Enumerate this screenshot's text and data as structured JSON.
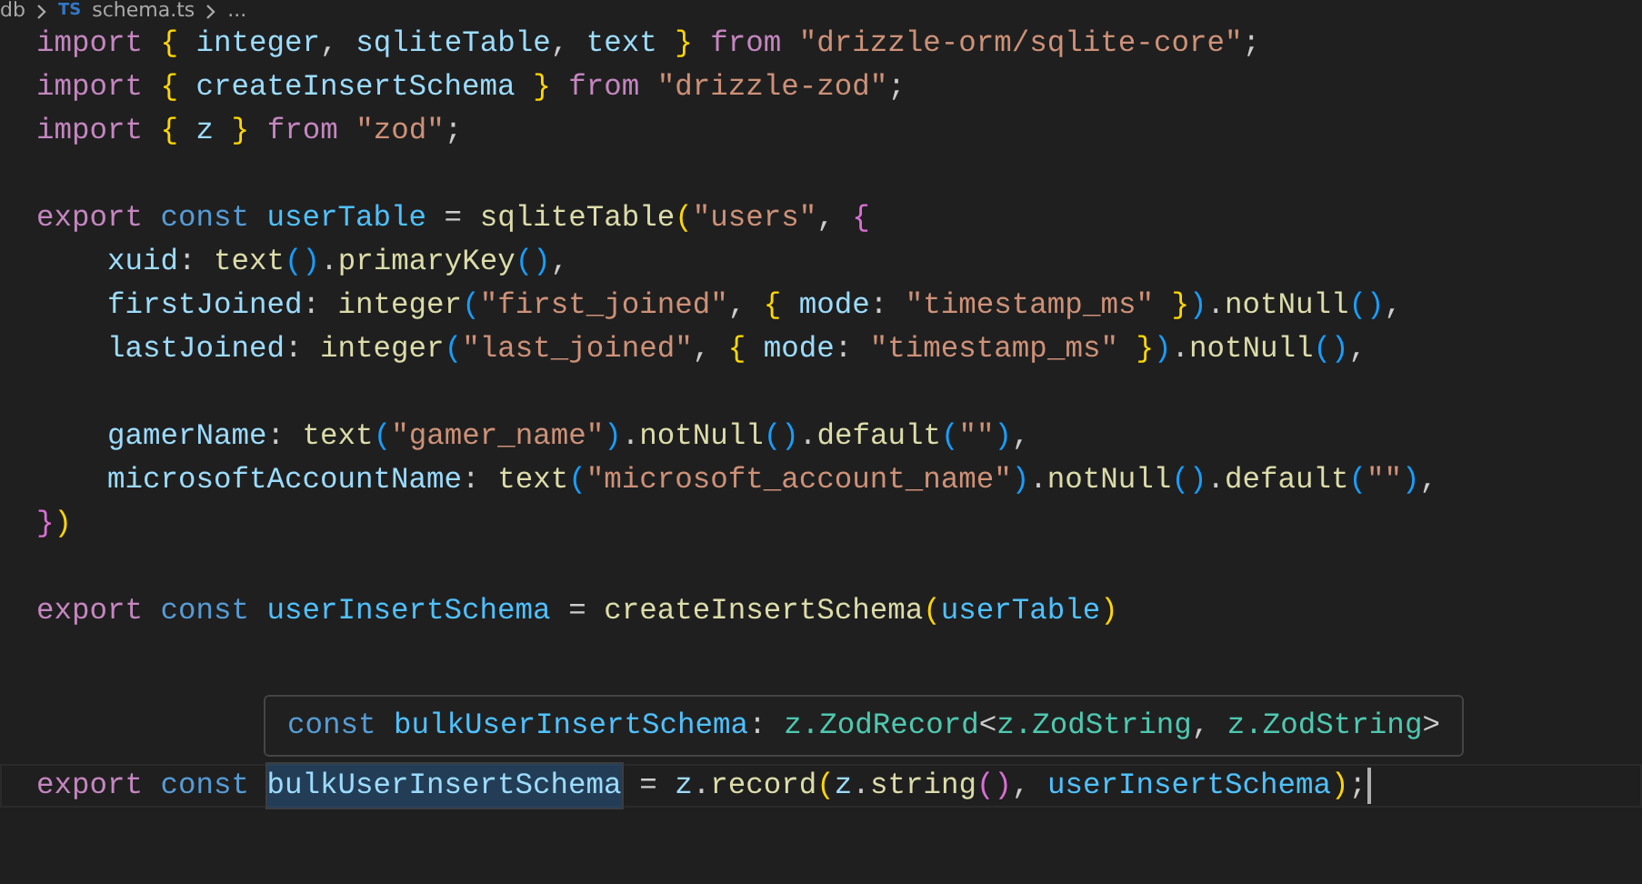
{
  "breadcrumb": {
    "folder": "db",
    "file_icon": "TS",
    "file": "schema.ts",
    "more": "..."
  },
  "code_lines": [
    {
      "tokens": [
        {
          "kind": "kw",
          "text": "import"
        },
        {
          "kind": "b1",
          "text": " {"
        },
        {
          "kind": "var",
          "text": " integer"
        },
        {
          "kind": "plain",
          "text": ", "
        },
        {
          "kind": "var",
          "text": "sqliteTable"
        },
        {
          "kind": "plain",
          "text": ", "
        },
        {
          "kind": "var",
          "text": "text "
        },
        {
          "kind": "b1",
          "text": "}"
        },
        {
          "kind": "kw",
          "text": " from "
        },
        {
          "kind": "str",
          "text": "\"drizzle-orm/sqlite-core\""
        },
        {
          "kind": "plain",
          "text": ";"
        }
      ]
    },
    {
      "tokens": [
        {
          "kind": "kw",
          "text": "import"
        },
        {
          "kind": "b1",
          "text": " {"
        },
        {
          "kind": "var",
          "text": " createInsertSchema "
        },
        {
          "kind": "b1",
          "text": "}"
        },
        {
          "kind": "kw",
          "text": " from "
        },
        {
          "kind": "str",
          "text": "\"drizzle-zod\""
        },
        {
          "kind": "plain",
          "text": ";"
        }
      ]
    },
    {
      "tokens": [
        {
          "kind": "kw",
          "text": "import"
        },
        {
          "kind": "b1",
          "text": " {"
        },
        {
          "kind": "var",
          "text": " z "
        },
        {
          "kind": "b1",
          "text": "}"
        },
        {
          "kind": "kw",
          "text": " from "
        },
        {
          "kind": "str",
          "text": "\"zod\""
        },
        {
          "kind": "plain",
          "text": ";"
        }
      ]
    },
    {
      "blank_line_before": true,
      "tokens": [
        {
          "kind": "kw",
          "text": "export"
        },
        {
          "kind": "storage",
          "text": " const "
        },
        {
          "kind": "const",
          "text": "userTable"
        },
        {
          "kind": "plain",
          "text": " = "
        },
        {
          "kind": "fn",
          "text": "sqliteTable"
        },
        {
          "kind": "b1",
          "text": "("
        },
        {
          "kind": "str",
          "text": "\"users\""
        },
        {
          "kind": "plain",
          "text": ", "
        },
        {
          "kind": "b2",
          "text": "{"
        }
      ]
    },
    {
      "tokens": [
        {
          "kind": "var",
          "text": "    xuid"
        },
        {
          "kind": "plain",
          "text": ": "
        },
        {
          "kind": "fn",
          "text": "text"
        },
        {
          "kind": "b3",
          "text": "()"
        },
        {
          "kind": "plain",
          "text": "."
        },
        {
          "kind": "fn",
          "text": "primaryKey"
        },
        {
          "kind": "b3",
          "text": "()"
        },
        {
          "kind": "plain",
          "text": ","
        }
      ]
    },
    {
      "tokens": [
        {
          "kind": "var",
          "text": "    firstJoined"
        },
        {
          "kind": "plain",
          "text": ": "
        },
        {
          "kind": "fn",
          "text": "integer"
        },
        {
          "kind": "b3",
          "text": "("
        },
        {
          "kind": "str",
          "text": "\"first_joined\""
        },
        {
          "kind": "plain",
          "text": ", "
        },
        {
          "kind": "b1",
          "text": "{"
        },
        {
          "kind": "var",
          "text": " mode"
        },
        {
          "kind": "plain",
          "text": ": "
        },
        {
          "kind": "str",
          "text": "\"timestamp_ms\""
        },
        {
          "kind": "b1",
          "text": " }"
        },
        {
          "kind": "b3",
          "text": ")"
        },
        {
          "kind": "plain",
          "text": "."
        },
        {
          "kind": "fn",
          "text": "notNull"
        },
        {
          "kind": "b3",
          "text": "()"
        },
        {
          "kind": "plain",
          "text": ","
        }
      ]
    },
    {
      "tokens": [
        {
          "kind": "var",
          "text": "    lastJoined"
        },
        {
          "kind": "plain",
          "text": ": "
        },
        {
          "kind": "fn",
          "text": "integer"
        },
        {
          "kind": "b3",
          "text": "("
        },
        {
          "kind": "str",
          "text": "\"last_joined\""
        },
        {
          "kind": "plain",
          "text": ", "
        },
        {
          "kind": "b1",
          "text": "{"
        },
        {
          "kind": "var",
          "text": " mode"
        },
        {
          "kind": "plain",
          "text": ": "
        },
        {
          "kind": "str",
          "text": "\"timestamp_ms\""
        },
        {
          "kind": "b1",
          "text": " }"
        },
        {
          "kind": "b3",
          "text": ")"
        },
        {
          "kind": "plain",
          "text": "."
        },
        {
          "kind": "fn",
          "text": "notNull"
        },
        {
          "kind": "b3",
          "text": "()"
        },
        {
          "kind": "plain",
          "text": ","
        }
      ]
    },
    {
      "blank_line_before": true,
      "tokens": [
        {
          "kind": "var",
          "text": "    gamerName"
        },
        {
          "kind": "plain",
          "text": ": "
        },
        {
          "kind": "fn",
          "text": "text"
        },
        {
          "kind": "b3",
          "text": "("
        },
        {
          "kind": "str",
          "text": "\"gamer_name\""
        },
        {
          "kind": "b3",
          "text": ")"
        },
        {
          "kind": "plain",
          "text": "."
        },
        {
          "kind": "fn",
          "text": "notNull"
        },
        {
          "kind": "b3",
          "text": "()"
        },
        {
          "kind": "plain",
          "text": "."
        },
        {
          "kind": "fn",
          "text": "default"
        },
        {
          "kind": "b3",
          "text": "("
        },
        {
          "kind": "str",
          "text": "\"\""
        },
        {
          "kind": "b3",
          "text": ")"
        },
        {
          "kind": "plain",
          "text": ","
        }
      ]
    },
    {
      "tokens": [
        {
          "kind": "var",
          "text": "    microsoftAccountName"
        },
        {
          "kind": "plain",
          "text": ": "
        },
        {
          "kind": "fn",
          "text": "text"
        },
        {
          "kind": "b3",
          "text": "("
        },
        {
          "kind": "str",
          "text": "\"microsoft_account_name\""
        },
        {
          "kind": "b3",
          "text": ")"
        },
        {
          "kind": "plain",
          "text": "."
        },
        {
          "kind": "fn",
          "text": "notNull"
        },
        {
          "kind": "b3",
          "text": "()"
        },
        {
          "kind": "plain",
          "text": "."
        },
        {
          "kind": "fn",
          "text": "default"
        },
        {
          "kind": "b3",
          "text": "("
        },
        {
          "kind": "str",
          "text": "\"\""
        },
        {
          "kind": "b3",
          "text": ")"
        },
        {
          "kind": "plain",
          "text": ","
        }
      ]
    },
    {
      "tokens": [
        {
          "kind": "b2",
          "text": "}"
        },
        {
          "kind": "b1",
          "text": ")"
        }
      ]
    },
    {
      "blank_line_before": true,
      "tokens": [
        {
          "kind": "kw",
          "text": "export"
        },
        {
          "kind": "storage",
          "text": " const "
        },
        {
          "kind": "const",
          "text": "userInsertSchema"
        },
        {
          "kind": "plain",
          "text": " = "
        },
        {
          "kind": "fn",
          "text": "createInsertSchema"
        },
        {
          "kind": "b1",
          "text": "("
        },
        {
          "kind": "const",
          "text": "userTable"
        },
        {
          "kind": "b1",
          "text": ")"
        }
      ]
    },
    {
      "three_blank_lines_before": true,
      "cursor": true,
      "tokens": [
        {
          "kind": "kw",
          "text": "export"
        },
        {
          "kind": "storage",
          "text": " const "
        },
        {
          "kind": "match",
          "text": "bulkUserInsertSchema"
        },
        {
          "kind": "plain",
          "text": " = "
        },
        {
          "kind": "var",
          "text": "z"
        },
        {
          "kind": "plain",
          "text": "."
        },
        {
          "kind": "fn",
          "text": "record"
        },
        {
          "kind": "b1",
          "text": "("
        },
        {
          "kind": "var",
          "text": "z"
        },
        {
          "kind": "plain",
          "text": "."
        },
        {
          "kind": "fn",
          "text": "string"
        },
        {
          "kind": "b2",
          "text": "()"
        },
        {
          "kind": "plain",
          "text": ", "
        },
        {
          "kind": "const",
          "text": "userInsertSchema"
        },
        {
          "kind": "b1",
          "text": ")"
        },
        {
          "kind": "plain",
          "text": ";"
        }
      ]
    }
  ],
  "hover_tooltip": {
    "tokens": [
      {
        "kind": "storage",
        "text": "const "
      },
      {
        "kind": "const",
        "text": "bulkUserInsertSchema"
      },
      {
        "kind": "plain",
        "text": ": "
      },
      {
        "kind": "type",
        "text": "z.ZodRecord"
      },
      {
        "kind": "plain",
        "text": "<"
      },
      {
        "kind": "type",
        "text": "z.ZodString"
      },
      {
        "kind": "plain",
        "text": ", "
      },
      {
        "kind": "type",
        "text": "z.ZodString"
      },
      {
        "kind": "plain",
        "text": ">"
      }
    ]
  }
}
